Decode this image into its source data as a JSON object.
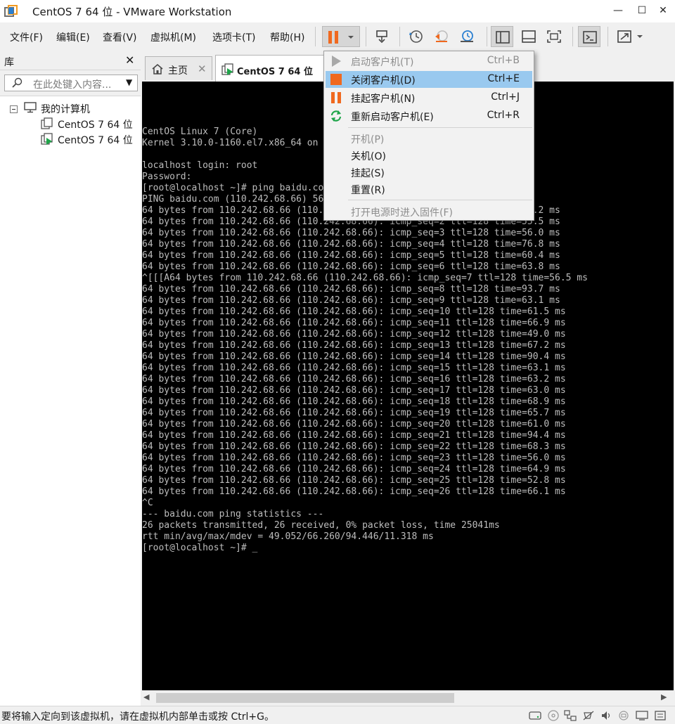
{
  "window": {
    "title": "CentOS 7 64 位 - VMware Workstation",
    "minimize": "—",
    "maximize": "☐",
    "close": "✕"
  },
  "menu": {
    "file": "文件(F)",
    "edit": "编辑(E)",
    "view": "查看(V)",
    "vm": "虚拟机(M)",
    "tabs": "选项卡(T)",
    "help": "帮助(H)"
  },
  "library": {
    "title": "库",
    "close": "✕",
    "search_placeholder": "在此处键入内容...",
    "root": "我的计算机",
    "items": [
      "CentOS 7 64 位",
      "CentOS 7 64 位"
    ]
  },
  "tabs": {
    "home": "主页",
    "vm": "CentOS 7 64 位",
    "close": "✕"
  },
  "console_lines": [
    "CentOS Linux 7 (Core)",
    "Kernel 3.10.0-1160.el7.x86_64 on",
    "",
    "localhost login: root",
    "Password:",
    "[root@localhost ~]# ping baidu.co",
    "PING baidu.com (110.242.68.66) 56",
    "64 bytes from 110.242.68.66 (110.242.68.66): icmp_seq=1 ttl=128 time=53.2 ms",
    "64 bytes from 110.242.68.66 (110.242.68.66): icmp_seq=2 ttl=128 time=55.5 ms",
    "64 bytes from 110.242.68.66 (110.242.68.66): icmp_seq=3 ttl=128 time=56.0 ms",
    "64 bytes from 110.242.68.66 (110.242.68.66): icmp_seq=4 ttl=128 time=76.8 ms",
    "64 bytes from 110.242.68.66 (110.242.68.66): icmp_seq=5 ttl=128 time=60.4 ms",
    "64 bytes from 110.242.68.66 (110.242.68.66): icmp_seq=6 ttl=128 time=63.8 ms",
    "^[[[A64 bytes from 110.242.68.66 (110.242.68.66): icmp_seq=7 ttl=128 time=56.5 ms",
    "64 bytes from 110.242.68.66 (110.242.68.66): icmp_seq=8 ttl=128 time=93.7 ms",
    "64 bytes from 110.242.68.66 (110.242.68.66): icmp_seq=9 ttl=128 time=63.1 ms",
    "64 bytes from 110.242.68.66 (110.242.68.66): icmp_seq=10 ttl=128 time=61.5 ms",
    "64 bytes from 110.242.68.66 (110.242.68.66): icmp_seq=11 ttl=128 time=66.9 ms",
    "64 bytes from 110.242.68.66 (110.242.68.66): icmp_seq=12 ttl=128 time=49.0 ms",
    "64 bytes from 110.242.68.66 (110.242.68.66): icmp_seq=13 ttl=128 time=67.2 ms",
    "64 bytes from 110.242.68.66 (110.242.68.66): icmp_seq=14 ttl=128 time=90.4 ms",
    "64 bytes from 110.242.68.66 (110.242.68.66): icmp_seq=15 ttl=128 time=63.1 ms",
    "64 bytes from 110.242.68.66 (110.242.68.66): icmp_seq=16 ttl=128 time=63.2 ms",
    "64 bytes from 110.242.68.66 (110.242.68.66): icmp_seq=17 ttl=128 time=63.0 ms",
    "64 bytes from 110.242.68.66 (110.242.68.66): icmp_seq=18 ttl=128 time=68.9 ms",
    "64 bytes from 110.242.68.66 (110.242.68.66): icmp_seq=19 ttl=128 time=65.7 ms",
    "64 bytes from 110.242.68.66 (110.242.68.66): icmp_seq=20 ttl=128 time=61.0 ms",
    "64 bytes from 110.242.68.66 (110.242.68.66): icmp_seq=21 ttl=128 time=94.4 ms",
    "64 bytes from 110.242.68.66 (110.242.68.66): icmp_seq=22 ttl=128 time=68.3 ms",
    "64 bytes from 110.242.68.66 (110.242.68.66): icmp_seq=23 ttl=128 time=56.0 ms",
    "64 bytes from 110.242.68.66 (110.242.68.66): icmp_seq=24 ttl=128 time=64.9 ms",
    "64 bytes from 110.242.68.66 (110.242.68.66): icmp_seq=25 ttl=128 time=52.8 ms",
    "64 bytes from 110.242.68.66 (110.242.68.66): icmp_seq=26 ttl=128 time=66.1 ms",
    "^C",
    "--- baidu.com ping statistics ---",
    "26 packets transmitted, 26 received, 0% packet loss, time 25041ms",
    "rtt min/avg/max/mdev = 49.052/66.260/94.446/11.318 ms",
    "[root@localhost ~]# _"
  ],
  "power_menu": {
    "start_guest": {
      "label": "启动客户机(T)",
      "shortcut": "Ctrl+B"
    },
    "shutdown_guest": {
      "label": "关闭客户机(D)",
      "shortcut": "Ctrl+E"
    },
    "suspend_guest": {
      "label": "挂起客户机(N)",
      "shortcut": "Ctrl+J"
    },
    "restart_guest": {
      "label": "重新启动客户机(E)",
      "shortcut": "Ctrl+R"
    },
    "power_on": "开机(P)",
    "power_off": "关机(O)",
    "suspend": "挂起(S)",
    "reset": "重置(R)",
    "firmware": "打开电源时进入固件(F)"
  },
  "scroll": {
    "left": "◀",
    "right": "▶"
  },
  "status": {
    "text": "要将输入定向到该虚拟机，请在虚拟机内部单击或按 Ctrl+G。"
  },
  "colors": {
    "accent_orange": "#f0691f",
    "highlight": "#99c9ef",
    "console_bg": "#000000",
    "console_fg": "#bdbdbd",
    "green": "#1fa54a"
  }
}
